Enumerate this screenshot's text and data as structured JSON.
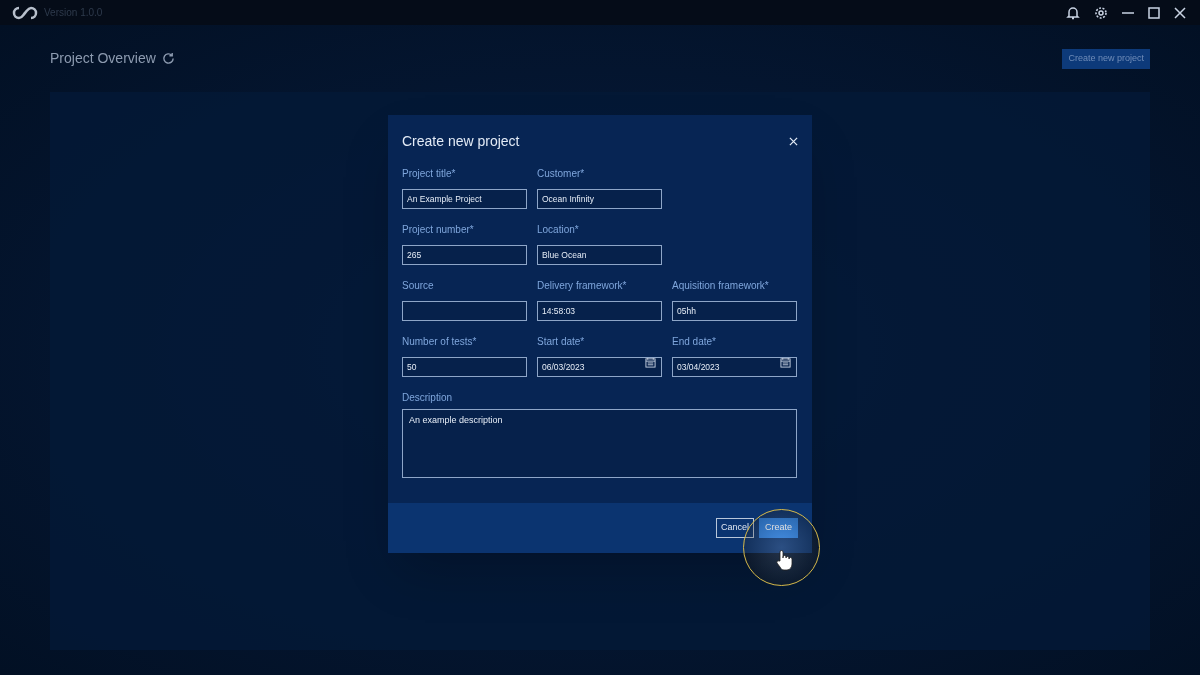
{
  "title_bar": {
    "version": "Version 1.0.0"
  },
  "page": {
    "title": "Project Overview",
    "create_button": "Create new project"
  },
  "dialog": {
    "title": "Create new project",
    "rows": [
      [
        {
          "label": "Project title*",
          "value": "An Example Project",
          "kind": "text"
        },
        {
          "label": "Customer*",
          "value": "Ocean Infinity",
          "kind": "text"
        }
      ],
      [
        {
          "label": "Project number*",
          "value": "265",
          "kind": "text"
        },
        {
          "label": "Location*",
          "value": "Blue Ocean",
          "kind": "text"
        }
      ],
      [
        {
          "label": "Source",
          "kind": "text"
        },
        {
          "label": "Delivery framework*",
          "value": "14:58:03",
          "kind": "text"
        },
        {
          "label": "Aquisition framework*",
          "value": "05hh",
          "kind": "text"
        }
      ],
      [
        {
          "label": "Number of tests*",
          "value": "50",
          "kind": "text"
        },
        {
          "label": "Start date*",
          "value": "06/03/2023",
          "kind": "date"
        },
        {
          "label": "End date*",
          "value": "03/04/2023",
          "kind": "date"
        }
      ]
    ],
    "description": {
      "label": "Description",
      "value": "An example description"
    },
    "buttons": [
      {
        "label": "Cancel",
        "kind": "secondary"
      },
      {
        "label": "Create",
        "kind": "primary"
      }
    ]
  }
}
